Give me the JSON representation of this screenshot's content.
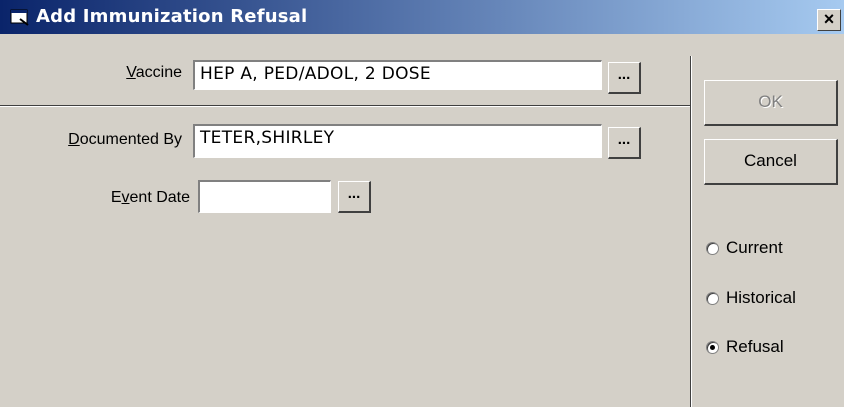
{
  "window": {
    "title": "Add Immunization Refusal",
    "close_glyph": "✕"
  },
  "form": {
    "vaccine": {
      "label_underlined": "V",
      "label_rest": "accine",
      "value": "HEP A, PED/ADOL, 2 DOSE",
      "lookup_label": "..."
    },
    "documented_by": {
      "label_underlined": "D",
      "label_rest": "ocumented By",
      "value": "TETER,SHIRLEY",
      "lookup_label": "..."
    },
    "event_date": {
      "label_pre": "E",
      "label_underlined": "v",
      "label_rest": "ent Date",
      "value": "",
      "lookup_label": "..."
    }
  },
  "buttons": {
    "ok": "OK",
    "cancel": "Cancel"
  },
  "radios": [
    {
      "label": "Current",
      "selected": false
    },
    {
      "label": "Historical",
      "selected": false
    },
    {
      "label": "Refusal",
      "selected": true
    }
  ],
  "icons": {
    "app": "syringe-window-icon",
    "close": "close-icon"
  }
}
